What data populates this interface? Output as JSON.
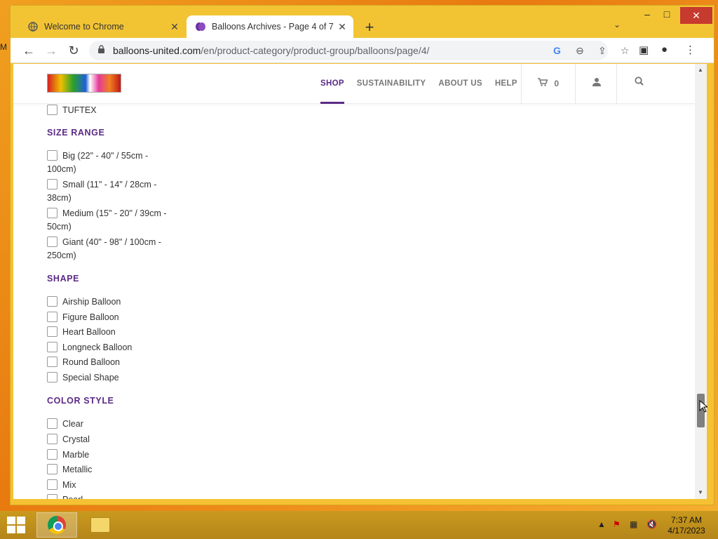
{
  "desktop": {
    "edge_glyph": "M"
  },
  "browser": {
    "tabs": [
      {
        "title": "Welcome to Chrome",
        "favicon": "globe-icon",
        "active": false
      },
      {
        "title": "Balloons Archives - Page 4 of 7 -",
        "favicon": "balloon-icon",
        "active": true
      }
    ],
    "url_domain": "balloons-united.com",
    "url_path": "/en/product-category/product-group/balloons/page/4/"
  },
  "site": {
    "nav": [
      "SHOP",
      "SUSTAINABILITY",
      "ABOUT US",
      "HELP"
    ],
    "active_nav": "SHOP",
    "cart_count": "0",
    "brand_color": "#5b2a86"
  },
  "filters": {
    "partial_item": "TUFTEX",
    "size_range": {
      "heading": "SIZE RANGE",
      "options": [
        "Big (22\" - 40\" / 55cm - 100cm)",
        "Small (11\" - 14\" / 28cm - 38cm)",
        "Medium (15\" - 20\" / 39cm - 50cm)",
        "Giant (40\" - 98\" / 100cm - 250cm)"
      ]
    },
    "shape": {
      "heading": "SHAPE",
      "options": [
        "Airship Balloon",
        "Figure Balloon",
        "Heart Balloon",
        "Longneck Balloon",
        "Round Balloon",
        "Special Shape"
      ]
    },
    "color_style": {
      "heading": "COLOR STYLE",
      "options": [
        "Clear",
        "Crystal",
        "Marble",
        "Metallic",
        "Mix",
        "Pearl"
      ]
    }
  },
  "taskbar": {
    "time": "7:37 AM",
    "date": "4/17/2023"
  }
}
